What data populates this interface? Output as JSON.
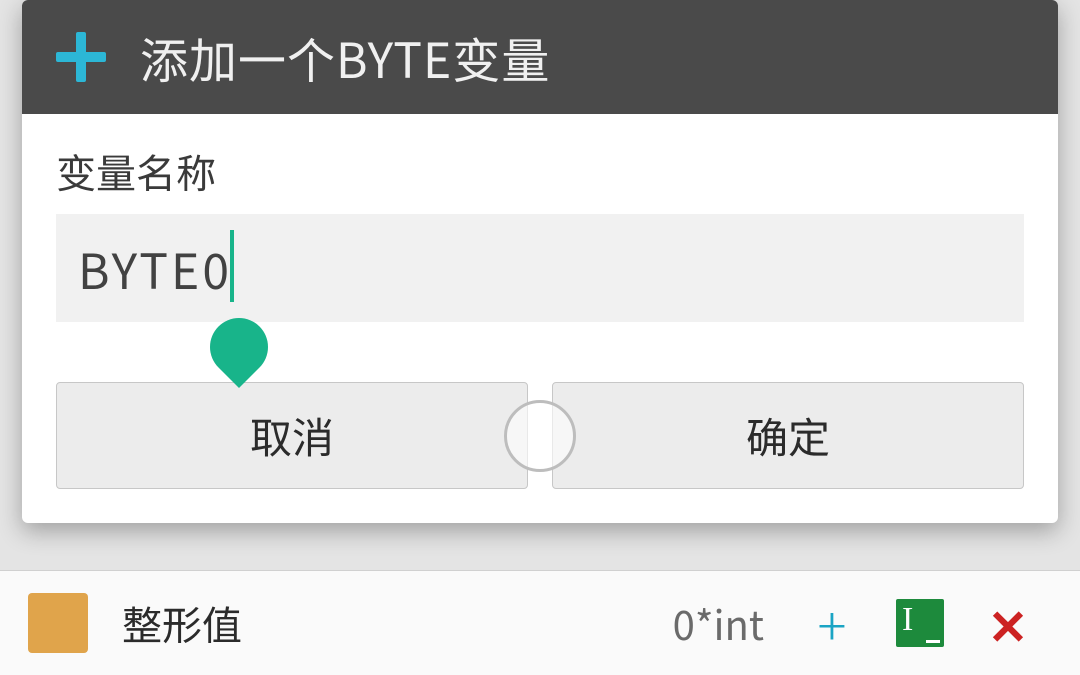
{
  "dialog": {
    "title": "添加一个BYTE变量",
    "field_label": "变量名称",
    "input_value": "BYTE0",
    "cancel_label": "取消",
    "confirm_label": "确定"
  },
  "background_row": {
    "label": "整形值",
    "type_text": "0*int"
  }
}
